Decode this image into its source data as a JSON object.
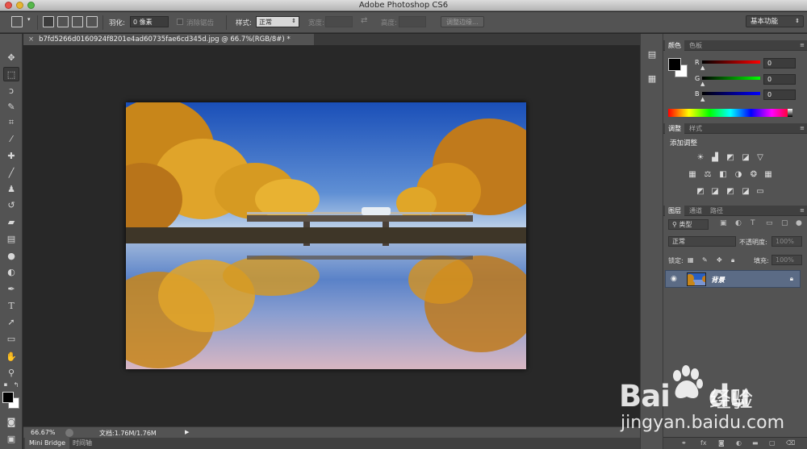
{
  "window": {
    "title": "Adobe Photoshop CS6"
  },
  "options_bar": {
    "feather_label": "羽化:",
    "feather_value": "0 像素",
    "antialias_label": "消除锯齿",
    "style_label": "样式:",
    "style_value": "正常",
    "width_label": "宽度:",
    "height_label": "高度:",
    "refine_edge_label": "调整边缘..."
  },
  "workspace": {
    "value": "基本功能"
  },
  "document": {
    "tab_title": "b7fd5266d0160924f8201e4ad60735fae6cd345d.jpg @ 66.7%(RGB/8#) *"
  },
  "status_bar": {
    "zoom": "66.67%",
    "doc_info": "文档:1.76M/1.76M"
  },
  "bottom_tabs": [
    "Mini Bridge",
    "时间轴"
  ],
  "color_panel": {
    "tabs": [
      "颜色",
      "色板"
    ],
    "channels": [
      {
        "label": "R",
        "value": "0"
      },
      {
        "label": "G",
        "value": "0"
      },
      {
        "label": "B",
        "value": "0"
      }
    ]
  },
  "adjustments_panel": {
    "tabs": [
      "调整",
      "样式"
    ],
    "title": "添加调整"
  },
  "layers_panel": {
    "tabs": [
      "图层",
      "通道",
      "路径"
    ],
    "filter_kind": "类型",
    "blend_mode": "正常",
    "opacity_label": "不透明度:",
    "opacity_value": "100%",
    "lock_label": "锁定:",
    "fill_label": "填充:",
    "fill_value": "100%",
    "layers": [
      {
        "name": "背景",
        "locked": true,
        "visible": true
      }
    ]
  },
  "watermark": {
    "brand_latin": "Bai",
    "brand_latin_2": "du",
    "brand_cn": "经验",
    "url": "jingyan.baidu.com"
  },
  "colors": {
    "layer_selected": "#5b6b85",
    "panel_bg": "#535353",
    "canvas_bg": "#282828"
  }
}
